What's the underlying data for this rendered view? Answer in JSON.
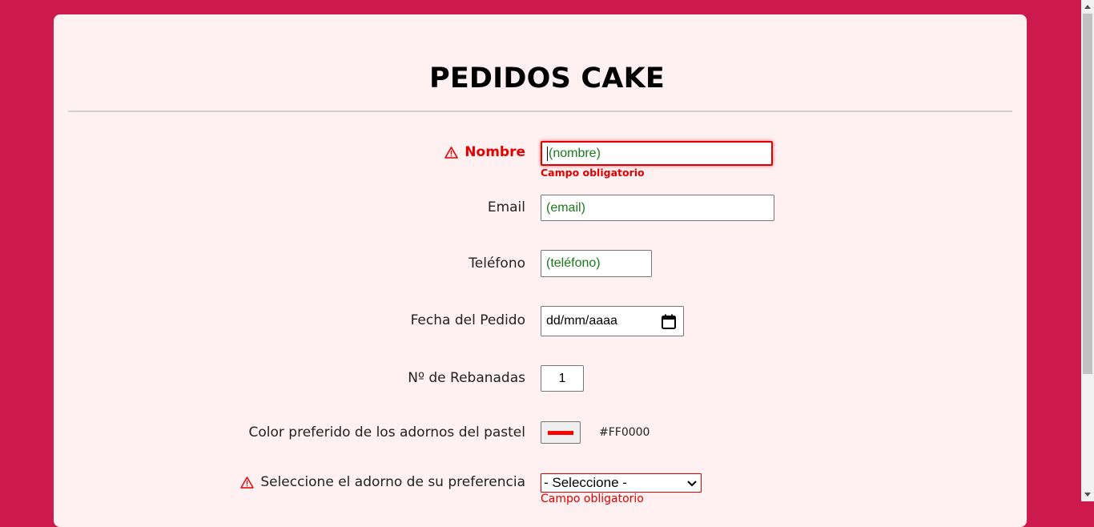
{
  "header": {
    "title": "PEDIDOS CAKE"
  },
  "form": {
    "nombre": {
      "label": "Nombre",
      "value": "(nombre)",
      "error": "Campo obligatorio"
    },
    "email": {
      "label": "Email",
      "value": "(email)"
    },
    "telefono": {
      "label": "Teléfono",
      "value": "(teléfono)"
    },
    "fecha": {
      "label": "Fecha del Pedido",
      "value": "dd/mm/aaaa"
    },
    "rebanadas": {
      "label": "Nº de Rebanadas",
      "value": "1"
    },
    "color": {
      "label": "Color preferido de los adornos del pastel",
      "value": "#FF0000",
      "swatch": "#ff0000"
    },
    "adorno": {
      "label": "Seleccione el adorno de su preferencia",
      "selected": "- Seleccione -",
      "error": "Campo obligatorio"
    }
  },
  "colors": {
    "background": "#cc1a4d",
    "card": "#fff0f2",
    "error": "#e00000",
    "input_text": "#1a7a1a"
  }
}
